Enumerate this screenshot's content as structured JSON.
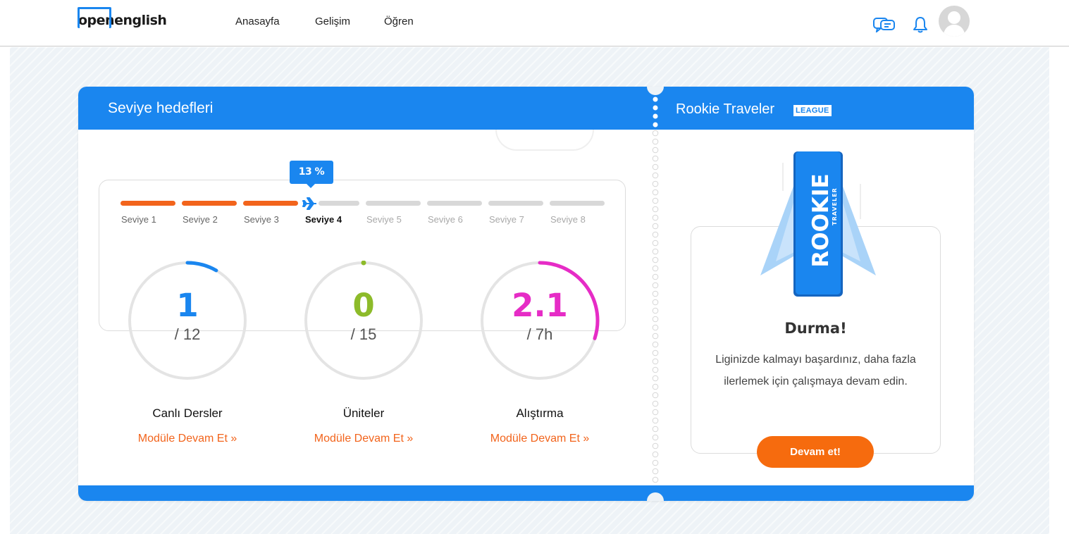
{
  "header": {
    "logo_open": "open",
    "logo_english": "english",
    "nav": {
      "home": "Anasayfa",
      "progress": "Gelişim",
      "learn": "Öğren"
    }
  },
  "colors": {
    "brand_blue": "#1a86ef",
    "orange": "#f2641c",
    "green": "#8dbb2a",
    "pink": "#e62cc6"
  },
  "level_goals": {
    "title": "Seviye hedefleri",
    "progress_badge": "13 %",
    "progress_fraction": 0.13,
    "levels": [
      {
        "label": "Seviye 1",
        "status": "done"
      },
      {
        "label": "Seviye 2",
        "status": "done"
      },
      {
        "label": "Seviye 3",
        "status": "done"
      },
      {
        "label": "Seviye 4",
        "status": "current"
      },
      {
        "label": "Seviye 5",
        "status": "future"
      },
      {
        "label": "Seviye 6",
        "status": "future"
      },
      {
        "label": "Seviye 7",
        "status": "future"
      },
      {
        "label": "Seviye 8",
        "status": "future"
      }
    ],
    "metrics": [
      {
        "value": "1",
        "total": "/ 12",
        "fraction": 0.083,
        "title": "Canlı Dersler",
        "link": "Modüle Devam Et »"
      },
      {
        "value": "0",
        "total": "/ 15",
        "fraction": 0.0,
        "title": "Üniteler",
        "link": "Modüle Devam Et »"
      },
      {
        "value": "2.1",
        "total": "/ 7h",
        "fraction": 0.3,
        "title": "Alıştırma",
        "link": "Modüle Devam Et »"
      }
    ]
  },
  "league": {
    "title": "Rookie Traveler",
    "badge": "LEAGUE",
    "art_text_main": "ROOKIE",
    "art_text_sub": "TRAVELER",
    "heading": "Durma!",
    "text": "Liginizde kalmayı başardınız, daha fazla ilerlemek için çalışmaya devam edin.",
    "button": "Devam et!"
  }
}
